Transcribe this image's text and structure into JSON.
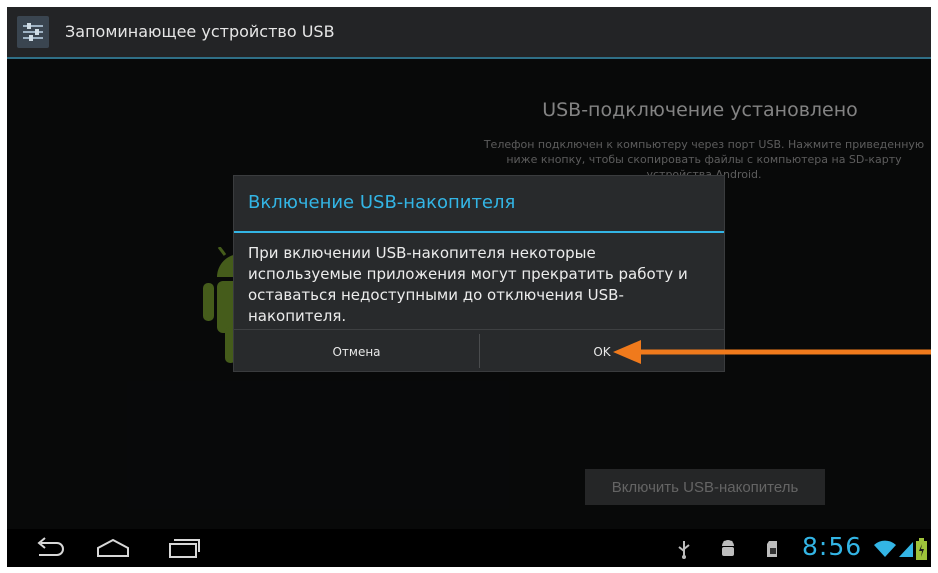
{
  "app": {
    "title": "Запоминающее устройство USB"
  },
  "main": {
    "heading": "USB-подключение установлено",
    "description": "Телефон подключен к компьютеру через порт USB. Нажмите приведенную ниже кнопку, чтобы скопировать файлы с компьютера на SD-карту устройства Android.",
    "enable_button": "Включить USB-накопитель"
  },
  "dialog": {
    "title": "Включение USB-накопителя",
    "message": "При включении USB-накопителя некоторые используемые приложения могут прекратить работу и оставаться недоступными до отключения USB-накопителя.",
    "cancel_label": "Отмена",
    "ok_label": "OK"
  },
  "status_bar": {
    "time": "8:56"
  },
  "icons": [
    "usb-settings-icon",
    "android-robot-icon",
    "back-icon",
    "home-icon",
    "recent-apps-icon",
    "usb-icon",
    "android-debug-icon",
    "sd-card-icon",
    "wifi-icon",
    "signal-icon",
    "battery-icon",
    "arrow-annotation-icon"
  ],
  "colors": {
    "accent": "#33b5e5",
    "arrow": "#f07a1c",
    "android_green": "#6a8e2a"
  }
}
